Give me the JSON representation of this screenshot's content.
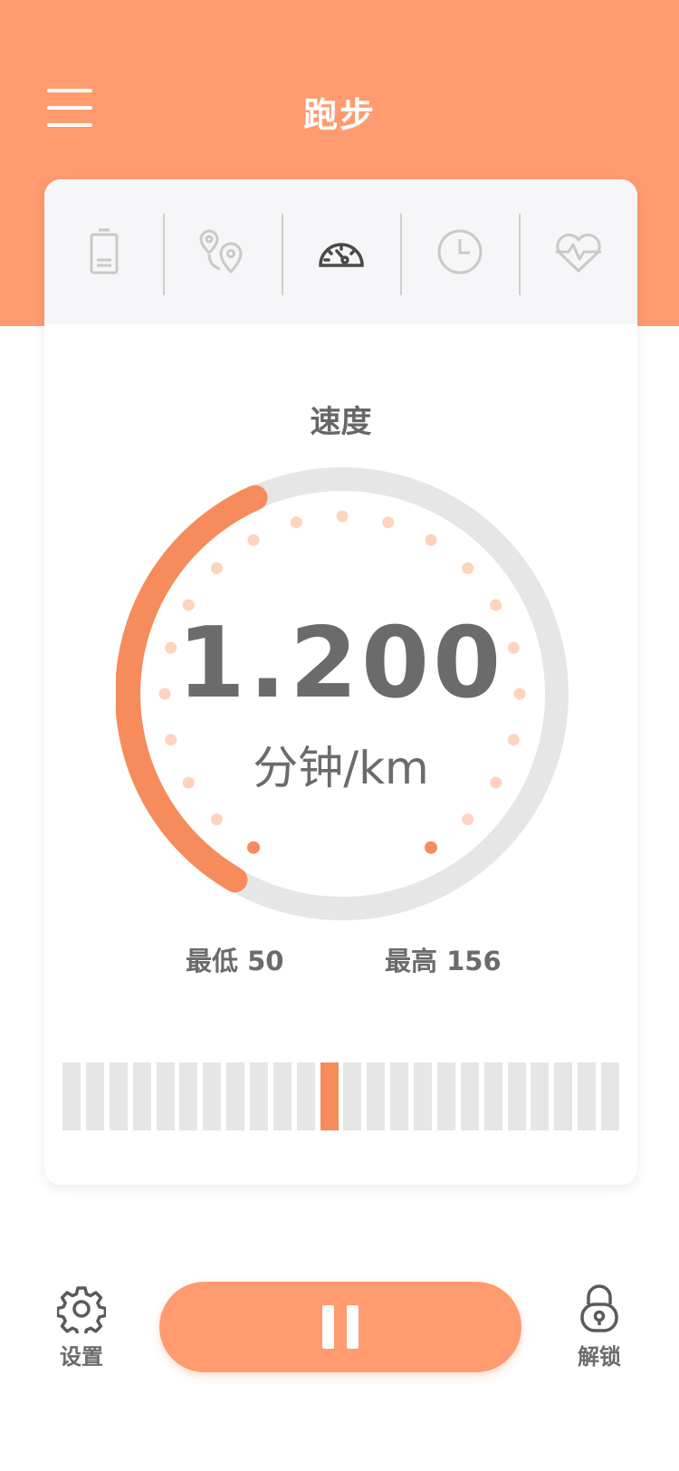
{
  "header": {
    "title": "跑步",
    "menu_icon": "hamburger-menu-icon"
  },
  "tabs": [
    {
      "id": "battery",
      "icon": "battery-icon",
      "active": false
    },
    {
      "id": "route",
      "icon": "map-pin-route-icon",
      "active": false
    },
    {
      "id": "speed",
      "icon": "speedometer-icon",
      "active": true
    },
    {
      "id": "time",
      "icon": "clock-icon",
      "active": false
    },
    {
      "id": "heart",
      "icon": "heart-rate-icon",
      "active": false
    }
  ],
  "metric": {
    "label": "速度",
    "value": "1.200",
    "unit": "分钟/km",
    "min_label": "最低 50",
    "max_label": "最高 156",
    "progress_fraction": 0.42
  },
  "slider": {
    "segment_count": 24,
    "active_index": 11
  },
  "colors": {
    "accent": "#ff9b6f",
    "arc": "#f68c5c",
    "track": "#e6e6e6",
    "dot": "#ffd3bd",
    "text": "#6b6b6b",
    "tabbar_bg": "#f6f5f8"
  },
  "footer": {
    "settings_label": "设置",
    "unlock_label": "解锁",
    "settings_icon": "gear-icon",
    "unlock_icon": "padlock-icon",
    "pause_icon": "pause-icon"
  }
}
